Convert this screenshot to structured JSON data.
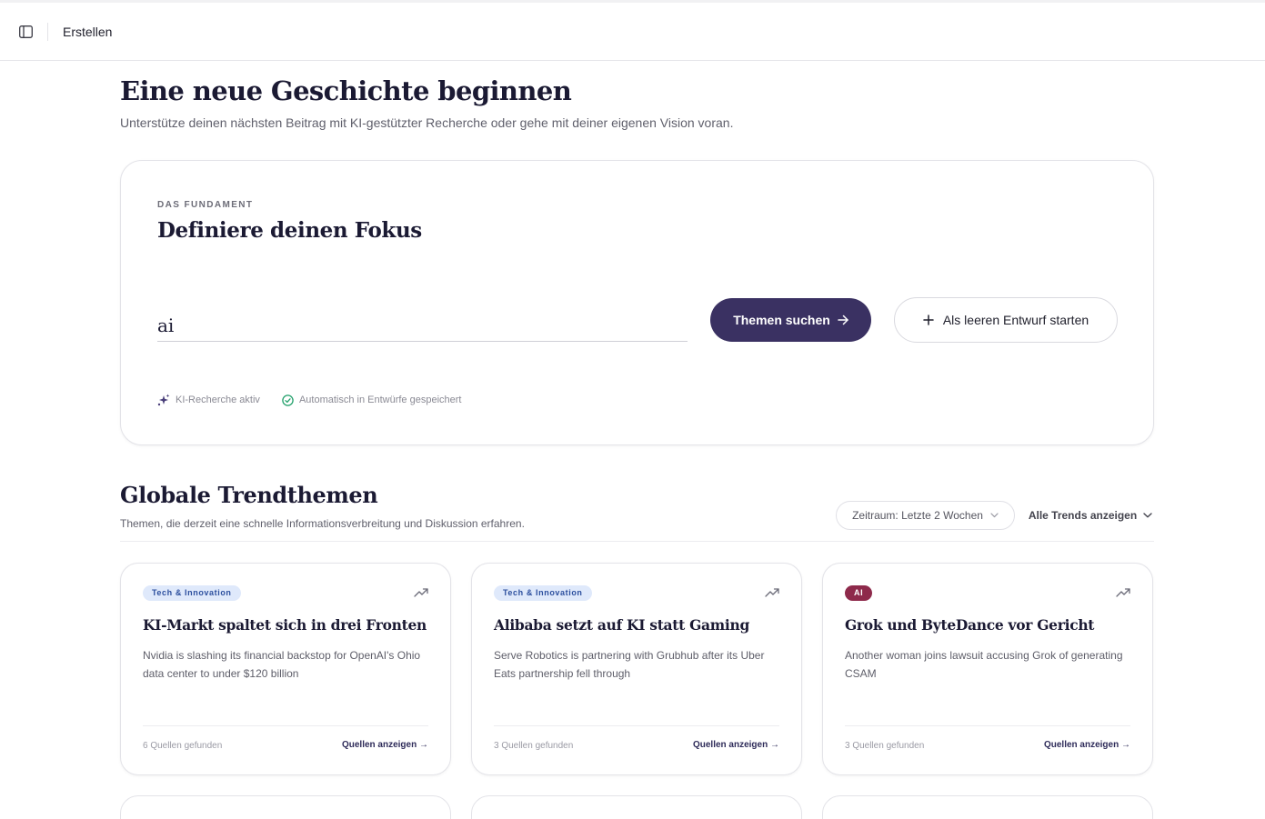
{
  "header": {
    "breadcrumb": "Erstellen",
    "sidebar_icon": "sidebar-toggle-icon"
  },
  "intro": {
    "title": "Eine neue Geschichte beginnen",
    "subtitle": "Unterstütze deinen nächsten Beitrag mit KI-gestützter Recherche oder gehe mit deiner eigenen Vision voran."
  },
  "focus": {
    "eyebrow": "DAS FUNDAMENT",
    "title": "Definiere deinen Fokus",
    "input_value": "ai",
    "primary_button": "Themen suchen",
    "secondary_button": "Als leeren Entwurf starten",
    "status": [
      {
        "label": "KI-Recherche aktiv",
        "icon": "sparkles-icon"
      },
      {
        "label": "Automatisch in Entwürfe gespeichert",
        "icon": "check-circle-icon"
      }
    ]
  },
  "trends": {
    "title": "Globale Trendthemen",
    "subtitle": "Themen, die derzeit eine schnelle Informationsverbreitung und Diskussion erfahren.",
    "period_select": "Zeitraum: Letzte 2 Wochen",
    "all_trends": "Alle Trends anzeigen",
    "cards": [
      {
        "tag": "Tech & Innovation",
        "title": "KI-Markt spaltet sich in drei Fronten",
        "description": "Nvidia is slashing its financial backstop for OpenAI's Ohio data center to under $120 billion",
        "sources": "6 Quellen gefunden",
        "link": "Quellen anzeigen →"
      },
      {
        "tag": "Tech & Innovation",
        "title": "Alibaba setzt auf KI statt Gaming",
        "description": "Serve Robotics is partnering with Grubhub after its Uber Eats partnership fell through",
        "sources": "3 Quellen gefunden",
        "link": "Quellen anzeigen →"
      },
      {
        "tag": "AI",
        "title": "Grok und ByteDance vor Gericht",
        "description": "Another woman joins lawsuit accusing Grok of generating CSAM",
        "sources": "3 Quellen gefunden",
        "link": "Quellen anzeigen →"
      }
    ]
  },
  "colors": {
    "primary": "#3a3162",
    "tag_tech_bg": "#dfe9fb",
    "tag_tech_text": "#2c4f9e",
    "tag_ai_bg": "#8e2a4b",
    "tag_ai_text": "#ffffff",
    "check_green": "#22a06b"
  }
}
